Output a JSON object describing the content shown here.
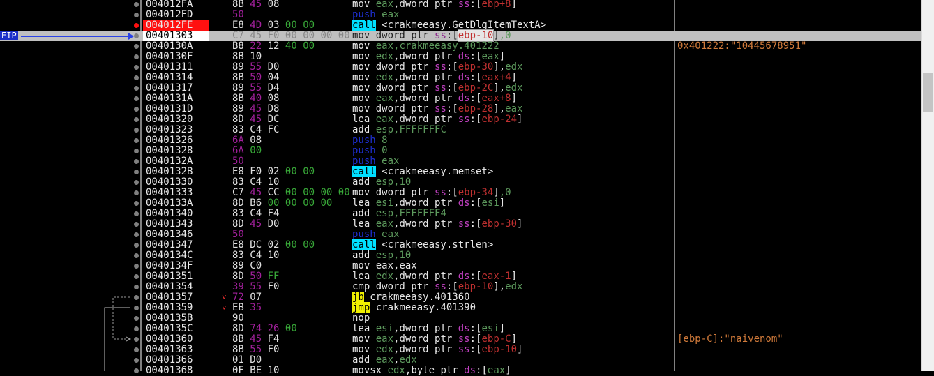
{
  "eip_label": "EIP",
  "colors": {
    "breakpoint": "#ff1010",
    "eip_arrow": "#2a42e6",
    "call_bg": "#00e0ff",
    "jmp_bg": "#f0f000",
    "comment": "#d17a3a"
  },
  "rows": [
    {
      "addr": "004012FA",
      "bytes": [
        [
          "8B",
          "d"
        ],
        [
          "45",
          "m"
        ],
        [
          "08",
          "d"
        ]
      ],
      "asm": [
        [
          "mov ",
          "mn"
        ],
        [
          "eax",
          "reg"
        ],
        [
          ",",
          "mn"
        ],
        [
          "dword ptr ",
          "kw"
        ],
        [
          "ss",
          "seg"
        ],
        [
          ":[",
          "br"
        ],
        [
          "ebp+8",
          "ebp"
        ],
        [
          "]",
          "br"
        ]
      ]
    },
    {
      "addr": "004012FD",
      "bytes": [
        [
          "50",
          "m"
        ]
      ],
      "asm": [
        [
          "push ",
          "pu"
        ],
        [
          "eax",
          "reg"
        ]
      ]
    },
    {
      "addr": "004012FE",
      "hl": true,
      "bp": "hit",
      "bytes": [
        [
          "E8",
          "d"
        ],
        [
          "4D",
          "m"
        ],
        [
          "03",
          "d"
        ],
        [
          "00",
          "i"
        ],
        [
          "00",
          "i"
        ]
      ],
      "asm": [
        [
          "call",
          "cb"
        ],
        [
          " <crakmeeasy.GetDlgItemTextA>",
          "lbl"
        ]
      ]
    },
    {
      "addr": "00401303",
      "cur": true,
      "bytes": [
        [
          "C7",
          "d"
        ],
        [
          "45",
          "m"
        ],
        [
          "F0",
          "d"
        ],
        [
          "00",
          "i"
        ],
        [
          "00",
          "i"
        ],
        [
          "00",
          "i"
        ],
        [
          "00",
          "i"
        ]
      ],
      "asm": [
        [
          "mov ",
          "mn"
        ],
        [
          "dword ptr ",
          "kw"
        ],
        [
          "ss",
          "seg"
        ],
        [
          ":[",
          "br"
        ],
        [
          "ebp-10",
          "ebp"
        ],
        [
          "]",
          "br"
        ],
        [
          ",0",
          "num"
        ]
      ]
    },
    {
      "addr": "0040130A",
      "bytes": [
        [
          "B8",
          "d"
        ],
        [
          "22",
          "m"
        ],
        [
          "12",
          "d"
        ],
        [
          "40",
          "i"
        ],
        [
          "00",
          "i"
        ]
      ],
      "asm": [
        [
          "mov ",
          "mn"
        ],
        [
          "eax",
          "reg"
        ],
        [
          ",crakmeeasy.401222",
          "cm"
        ]
      ],
      "comment": "0x401222:\"10445678951\""
    },
    {
      "addr": "0040130F",
      "bytes": [
        [
          "8B",
          "d"
        ],
        [
          "10",
          "d"
        ]
      ],
      "asm": [
        [
          "mov ",
          "mn"
        ],
        [
          "edx",
          "reg"
        ],
        [
          ",",
          "mn"
        ],
        [
          "dword ptr ",
          "kw"
        ],
        [
          "ds",
          "seg"
        ],
        [
          ":[",
          "br"
        ],
        [
          "eax",
          "reg"
        ],
        [
          "]",
          "br"
        ]
      ]
    },
    {
      "addr": "00401311",
      "bytes": [
        [
          "89",
          "d"
        ],
        [
          "55",
          "m"
        ],
        [
          "D0",
          "d"
        ]
      ],
      "asm": [
        [
          "mov ",
          "mn"
        ],
        [
          "dword ptr ",
          "kw"
        ],
        [
          "ss",
          "seg"
        ],
        [
          ":[",
          "br"
        ],
        [
          "ebp-30",
          "ebp"
        ],
        [
          "],",
          "br"
        ],
        [
          "edx",
          "reg"
        ]
      ]
    },
    {
      "addr": "00401314",
      "bytes": [
        [
          "8B",
          "d"
        ],
        [
          "50",
          "m"
        ],
        [
          "04",
          "d"
        ]
      ],
      "asm": [
        [
          "mov ",
          "mn"
        ],
        [
          "edx",
          "reg"
        ],
        [
          ",",
          "mn"
        ],
        [
          "dword ptr ",
          "kw"
        ],
        [
          "ds",
          "seg"
        ],
        [
          ":[",
          "br"
        ],
        [
          "eax+4",
          "ebp"
        ],
        [
          "]",
          "br"
        ]
      ]
    },
    {
      "addr": "00401317",
      "bytes": [
        [
          "89",
          "d"
        ],
        [
          "55",
          "m"
        ],
        [
          "D4",
          "d"
        ]
      ],
      "asm": [
        [
          "mov ",
          "mn"
        ],
        [
          "dword ptr ",
          "kw"
        ],
        [
          "ss",
          "seg"
        ],
        [
          ":[",
          "br"
        ],
        [
          "ebp-2C",
          "ebp"
        ],
        [
          "],",
          "br"
        ],
        [
          "edx",
          "reg"
        ]
      ]
    },
    {
      "addr": "0040131A",
      "bytes": [
        [
          "8B",
          "d"
        ],
        [
          "40",
          "m"
        ],
        [
          "08",
          "d"
        ]
      ],
      "asm": [
        [
          "mov ",
          "mn"
        ],
        [
          "eax",
          "reg"
        ],
        [
          ",",
          "mn"
        ],
        [
          "dword ptr ",
          "kw"
        ],
        [
          "ds",
          "seg"
        ],
        [
          ":[",
          "br"
        ],
        [
          "eax+8",
          "ebp"
        ],
        [
          "]",
          "br"
        ]
      ]
    },
    {
      "addr": "0040131D",
      "bytes": [
        [
          "89",
          "d"
        ],
        [
          "45",
          "m"
        ],
        [
          "D8",
          "d"
        ]
      ],
      "asm": [
        [
          "mov ",
          "mn"
        ],
        [
          "dword ptr ",
          "kw"
        ],
        [
          "ss",
          "seg"
        ],
        [
          ":[",
          "br"
        ],
        [
          "ebp-28",
          "ebp"
        ],
        [
          "],",
          "br"
        ],
        [
          "eax",
          "reg"
        ]
      ]
    },
    {
      "addr": "00401320",
      "bytes": [
        [
          "8D",
          "d"
        ],
        [
          "45",
          "m"
        ],
        [
          "DC",
          "d"
        ]
      ],
      "asm": [
        [
          "lea ",
          "mn"
        ],
        [
          "eax",
          "reg"
        ],
        [
          ",",
          "mn"
        ],
        [
          "dword ptr ",
          "kw"
        ],
        [
          "ss",
          "seg"
        ],
        [
          ":[",
          "br"
        ],
        [
          "ebp-24",
          "ebp"
        ],
        [
          "]",
          "br"
        ]
      ]
    },
    {
      "addr": "00401323",
      "bytes": [
        [
          "83",
          "d"
        ],
        [
          "C4",
          "d"
        ],
        [
          "FC",
          "d"
        ]
      ],
      "asm": [
        [
          "add ",
          "mn"
        ],
        [
          "esp",
          "reg"
        ],
        [
          ",FFFFFFFC",
          "num"
        ]
      ]
    },
    {
      "addr": "00401326",
      "bytes": [
        [
          "6A",
          "m"
        ],
        [
          "08",
          "d"
        ]
      ],
      "asm": [
        [
          "push ",
          "pu"
        ],
        [
          "8",
          "num"
        ]
      ]
    },
    {
      "addr": "00401328",
      "bytes": [
        [
          "6A",
          "m"
        ],
        [
          "00",
          "i"
        ]
      ],
      "asm": [
        [
          "push ",
          "pu"
        ],
        [
          "0",
          "num"
        ]
      ]
    },
    {
      "addr": "0040132A",
      "bytes": [
        [
          "50",
          "m"
        ]
      ],
      "asm": [
        [
          "push ",
          "pu"
        ],
        [
          "eax",
          "reg"
        ]
      ]
    },
    {
      "addr": "0040132B",
      "bytes": [
        [
          "E8",
          "d"
        ],
        [
          "F0",
          "d"
        ],
        [
          "02",
          "d"
        ],
        [
          "00",
          "i"
        ],
        [
          "00",
          "i"
        ]
      ],
      "asm": [
        [
          "call",
          "cb"
        ],
        [
          " <crakmeeasy.memset>",
          "lbl"
        ]
      ]
    },
    {
      "addr": "00401330",
      "bytes": [
        [
          "83",
          "d"
        ],
        [
          "C4",
          "d"
        ],
        [
          "10",
          "d"
        ]
      ],
      "asm": [
        [
          "add ",
          "mn"
        ],
        [
          "esp",
          "reg"
        ],
        [
          ",10",
          "num"
        ]
      ]
    },
    {
      "addr": "00401333",
      "bytes": [
        [
          "C7",
          "d"
        ],
        [
          "45",
          "m"
        ],
        [
          "CC",
          "d"
        ],
        [
          "00",
          "i"
        ],
        [
          "00",
          "i"
        ],
        [
          "00",
          "i"
        ],
        [
          "00",
          "i"
        ]
      ],
      "asm": [
        [
          "mov ",
          "mn"
        ],
        [
          "dword ptr ",
          "kw"
        ],
        [
          "ss",
          "seg"
        ],
        [
          ":[",
          "br"
        ],
        [
          "ebp-34",
          "ebp"
        ],
        [
          "]",
          "br"
        ],
        [
          ",0",
          "num"
        ]
      ]
    },
    {
      "addr": "0040133A",
      "bytes": [
        [
          "8D",
          "d"
        ],
        [
          "B6",
          "d"
        ],
        [
          "00",
          "i"
        ],
        [
          "00",
          "i"
        ],
        [
          "00",
          "i"
        ],
        [
          "00",
          "i"
        ]
      ],
      "asm": [
        [
          "lea ",
          "mn"
        ],
        [
          "esi",
          "reg"
        ],
        [
          ",",
          "mn"
        ],
        [
          "dword ptr ",
          "kw"
        ],
        [
          "ds",
          "seg"
        ],
        [
          ":[",
          "br"
        ],
        [
          "esi",
          "reg"
        ],
        [
          "]",
          "br"
        ]
      ]
    },
    {
      "addr": "00401340",
      "bytes": [
        [
          "83",
          "d"
        ],
        [
          "C4",
          "d"
        ],
        [
          "F4",
          "d"
        ]
      ],
      "asm": [
        [
          "add ",
          "mn"
        ],
        [
          "esp",
          "reg"
        ],
        [
          ",FFFFFFF4",
          "num"
        ]
      ]
    },
    {
      "addr": "00401343",
      "bytes": [
        [
          "8D",
          "d"
        ],
        [
          "45",
          "m"
        ],
        [
          "D0",
          "d"
        ]
      ],
      "asm": [
        [
          "lea ",
          "mn"
        ],
        [
          "eax",
          "reg"
        ],
        [
          ",",
          "mn"
        ],
        [
          "dword ptr ",
          "kw"
        ],
        [
          "ss",
          "seg"
        ],
        [
          ":[",
          "br"
        ],
        [
          "ebp-30",
          "ebp"
        ],
        [
          "]",
          "br"
        ]
      ]
    },
    {
      "addr": "00401346",
      "bytes": [
        [
          "50",
          "m"
        ]
      ],
      "asm": [
        [
          "push ",
          "pu"
        ],
        [
          "eax",
          "reg"
        ]
      ]
    },
    {
      "addr": "00401347",
      "bytes": [
        [
          "E8",
          "d"
        ],
        [
          "DC",
          "d"
        ],
        [
          "02",
          "d"
        ],
        [
          "00",
          "i"
        ],
        [
          "00",
          "i"
        ]
      ],
      "asm": [
        [
          "call",
          "cb"
        ],
        [
          " <crakmeeasy.strlen>",
          "lbl"
        ]
      ]
    },
    {
      "addr": "0040134C",
      "bytes": [
        [
          "83",
          "d"
        ],
        [
          "C4",
          "d"
        ],
        [
          "10",
          "d"
        ]
      ],
      "asm": [
        [
          "add ",
          "mn"
        ],
        [
          "esp",
          "reg"
        ],
        [
          ",10",
          "num"
        ]
      ]
    },
    {
      "addr": "0040134F",
      "bytes": [
        [
          "89",
          "d"
        ],
        [
          "C0",
          "d"
        ]
      ],
      "asm": [
        [
          "mov ",
          "mn"
        ],
        [
          "eax,eax",
          "mn"
        ]
      ]
    },
    {
      "addr": "00401351",
      "bytes": [
        [
          "8D",
          "d"
        ],
        [
          "50",
          "m"
        ],
        [
          "FF",
          "i"
        ]
      ],
      "asm": [
        [
          "lea ",
          "mn"
        ],
        [
          "edx",
          "reg"
        ],
        [
          ",",
          "mn"
        ],
        [
          "dword ptr ",
          "kw"
        ],
        [
          "ds",
          "seg"
        ],
        [
          ":[",
          "br"
        ],
        [
          "eax-1",
          "ebp"
        ],
        [
          "]",
          "br"
        ]
      ]
    },
    {
      "addr": "00401354",
      "bytes": [
        [
          "39",
          "m"
        ],
        [
          "55",
          "m"
        ],
        [
          "F0",
          "d"
        ]
      ],
      "asm": [
        [
          "cmp ",
          "mn"
        ],
        [
          "dword ptr ",
          "kw"
        ],
        [
          "ss",
          "seg"
        ],
        [
          ":[",
          "br"
        ],
        [
          "ebp-10",
          "ebp"
        ],
        [
          "],",
          "br"
        ],
        [
          "edx",
          "reg"
        ]
      ]
    },
    {
      "addr": "00401357",
      "jm": "˅",
      "bytes": [
        [
          "72",
          "m"
        ],
        [
          "07",
          "d"
        ]
      ],
      "asm": [
        [
          "jb",
          "jmp"
        ],
        [
          " crakmeeasy.401360",
          "lbl"
        ]
      ]
    },
    {
      "addr": "00401359",
      "jm": "˅",
      "bytes": [
        [
          "EB",
          "d"
        ],
        [
          "35",
          "m"
        ]
      ],
      "asm": [
        [
          "jmp",
          "jmp"
        ],
        [
          " crakmeeasy.401390",
          "lbl"
        ]
      ]
    },
    {
      "addr": "0040135B",
      "bytes": [
        [
          "90",
          "d"
        ]
      ],
      "asm": [
        [
          "nop",
          "mn"
        ]
      ]
    },
    {
      "addr": "0040135C",
      "bytes": [
        [
          "8D",
          "d"
        ],
        [
          "74",
          "m"
        ],
        [
          "26",
          "m"
        ],
        [
          "00",
          "i"
        ]
      ],
      "asm": [
        [
          "lea ",
          "mn"
        ],
        [
          "esi",
          "reg"
        ],
        [
          ",",
          "mn"
        ],
        [
          "dword ptr ",
          "kw"
        ],
        [
          "ds",
          "seg"
        ],
        [
          ":[",
          "br"
        ],
        [
          "esi",
          "reg"
        ],
        [
          "]",
          "br"
        ]
      ]
    },
    {
      "addr": "00401360",
      "bytes": [
        [
          "8B",
          "d"
        ],
        [
          "45",
          "m"
        ],
        [
          "F4",
          "d"
        ]
      ],
      "asm": [
        [
          "mov ",
          "mn"
        ],
        [
          "eax",
          "reg"
        ],
        [
          ",",
          "mn"
        ],
        [
          "dword ptr ",
          "kw"
        ],
        [
          "ss",
          "seg"
        ],
        [
          ":[",
          "br"
        ],
        [
          "ebp-C",
          "ebp"
        ],
        [
          "]",
          "br"
        ]
      ],
      "comment": "[ebp-C]:\"naivenom\""
    },
    {
      "addr": "00401363",
      "bytes": [
        [
          "8B",
          "d"
        ],
        [
          "55",
          "m"
        ],
        [
          "F0",
          "d"
        ]
      ],
      "asm": [
        [
          "mov ",
          "mn"
        ],
        [
          "edx",
          "reg"
        ],
        [
          ",",
          "mn"
        ],
        [
          "dword ptr ",
          "kw"
        ],
        [
          "ss",
          "seg"
        ],
        [
          ":[",
          "br"
        ],
        [
          "ebp-10",
          "ebp"
        ],
        [
          "]",
          "br"
        ]
      ]
    },
    {
      "addr": "00401366",
      "bytes": [
        [
          "01",
          "d"
        ],
        [
          "D0",
          "d"
        ]
      ],
      "asm": [
        [
          "add ",
          "mn"
        ],
        [
          "eax",
          "reg"
        ],
        [
          ",",
          "mn"
        ],
        [
          "edx",
          "reg"
        ]
      ]
    },
    {
      "addr": "00401368",
      "bytes": [
        [
          "0F",
          "d"
        ],
        [
          "BE",
          "d"
        ],
        [
          "10",
          "d"
        ]
      ],
      "asm": [
        [
          "movsx ",
          "mn"
        ],
        [
          "edx",
          "reg"
        ],
        [
          ",",
          "mn"
        ],
        [
          "byte ptr ",
          "kw"
        ],
        [
          "ds",
          "seg"
        ],
        [
          ":[",
          "br"
        ],
        [
          "eax",
          "reg"
        ],
        [
          "]",
          "br"
        ]
      ]
    }
  ]
}
